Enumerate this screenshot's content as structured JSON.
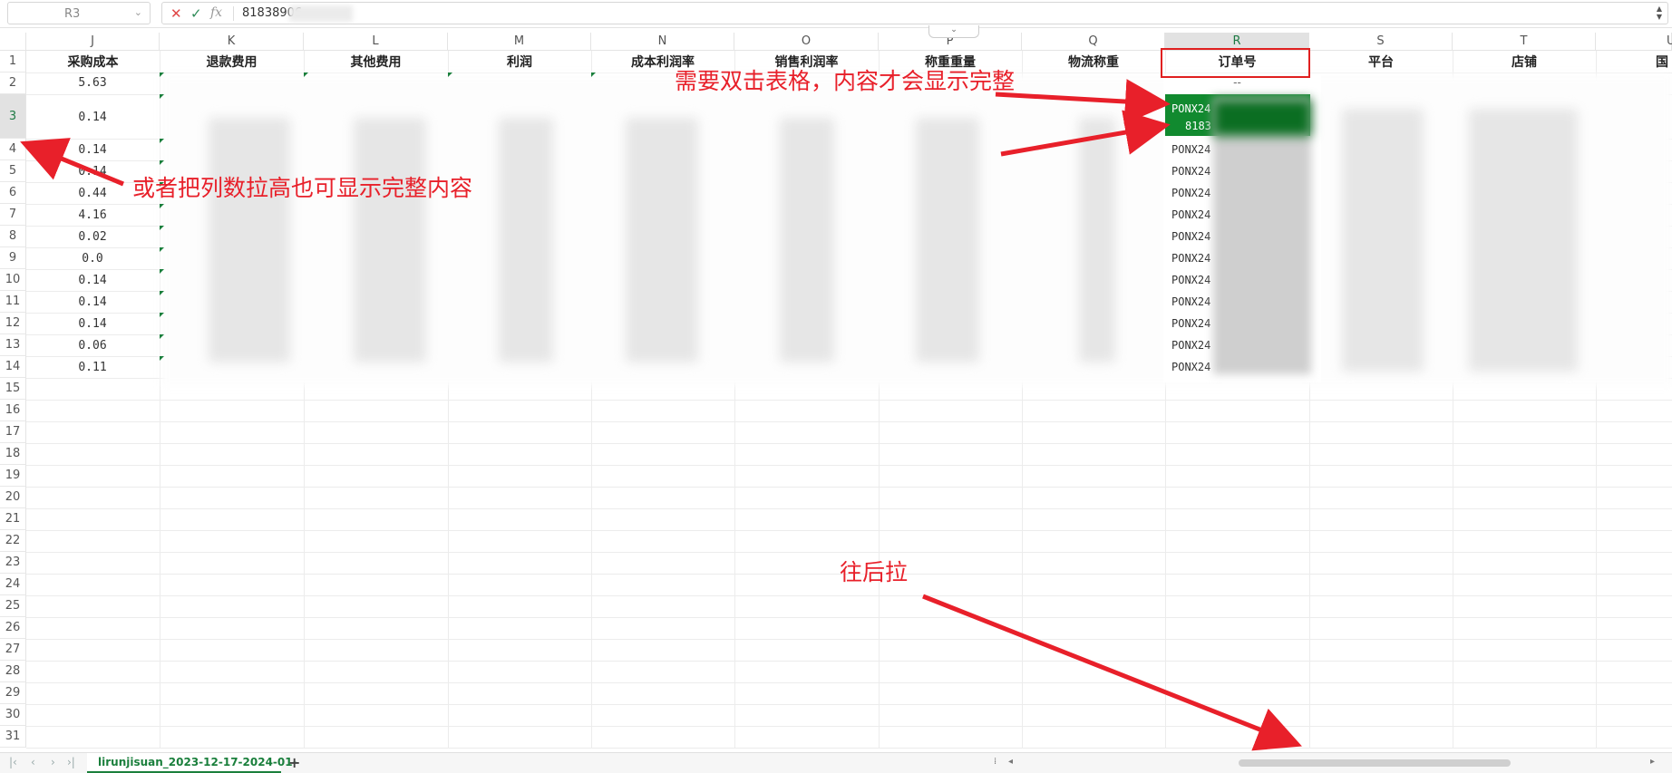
{
  "formula_bar": {
    "cell_ref": "R3",
    "value": "81838906",
    "fx": "fx",
    "cancel": "✕",
    "confirm": "✓"
  },
  "columns": {
    "letters": [
      "J",
      "K",
      "L",
      "M",
      "N",
      "O",
      "P",
      "Q",
      "R",
      "S",
      "T",
      "U"
    ],
    "selected": "R"
  },
  "rows": {
    "numbers": [
      "1",
      "2",
      "3",
      "4",
      "5",
      "6",
      "7",
      "8",
      "9",
      "10",
      "11",
      "12",
      "13",
      "14",
      "15",
      "16",
      "17",
      "18",
      "19",
      "20",
      "21",
      "22",
      "23",
      "24",
      "25",
      "26",
      "27",
      "28",
      "29",
      "30",
      "31"
    ],
    "selected": "3"
  },
  "header_row": {
    "J": "采购成本",
    "K": "退款费用",
    "L": "其他费用",
    "M": "利润",
    "N": "成本利润率",
    "O": "销售利润率",
    "P": "称重重量",
    "Q": "物流称重",
    "R": "订单号",
    "S": "平台",
    "T": "店铺",
    "U": "国"
  },
  "column_j_values": [
    "5.63",
    "0.14",
    "0.14",
    "0.14",
    "0.44",
    "4.16",
    "0.02",
    "0.0",
    "0.14",
    "0.14",
    "0.14",
    "0.06",
    "0.11"
  ],
  "column_r": {
    "row2": "--",
    "selected_line1": "PONX24",
    "selected_line2": "8183",
    "values": [
      "PONX24",
      "PONX24",
      "PONX24",
      "PONX24",
      "PONX24",
      "PONX24",
      "PONX24",
      "PONX24",
      "PONX24",
      "PONX24",
      "PONX24"
    ]
  },
  "annotations": {
    "double_click": "需要双击表格，内容才会显示完整",
    "row_height": "或者把列数拉高也可显示完整内容",
    "drag_back": "往后拉"
  },
  "sheet": {
    "tab_name": "lirunjisuan_2023-12-17-2024-01-",
    "add": "+"
  },
  "colors": {
    "accent_green": "#1a7f3c",
    "selection_fill": "#118a2f",
    "annotation_red": "#e8202a"
  }
}
